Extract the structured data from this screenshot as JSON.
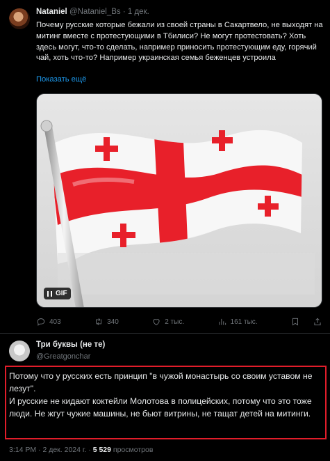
{
  "tweet1": {
    "name": "Nataniel",
    "handle": "@Nataniel_Bs",
    "dot": " · ",
    "date": "1 дек.",
    "text": "Почему русские которые бежали из своей страны в Сакартвело, не выходят на митинг вместе с протестующими в Тбилиси?  Не могут протестовать? Хоть здесь могут, что-то сделать, например приносить протестующим еду, горячий чай, хоть что-то? Например украинская семья беженцев устроила",
    "show_more": "Показать ещё",
    "media_badge": "GIF",
    "actions": {
      "replies": "403",
      "reposts": "340",
      "likes": "2 тыс.",
      "views": "161 тыс."
    }
  },
  "tweet2": {
    "name": "Три буквы (не те)",
    "handle": "@Greatgonchar",
    "text": "Потому что у русских есть принцип \"в чужой монастырь со своим уставом не лезут\".\nИ русские не кидают коктейли Молотова в полицейских, потому что это тоже люди. Не жгут чужие машины, не бьют витрины, не тащат детей на митинги.",
    "time": "3:14 PM",
    "date": "2 дек. 2024 г.",
    "views_count": "5 529",
    "views_label": "просмотров",
    "sep": " · "
  },
  "colors": {
    "background": "#000000",
    "text": "#e7e9ea",
    "muted": "#71767b",
    "link": "#1d9bf0",
    "highlight_box": "#e11d2a",
    "flag_red": "#e8202a"
  }
}
